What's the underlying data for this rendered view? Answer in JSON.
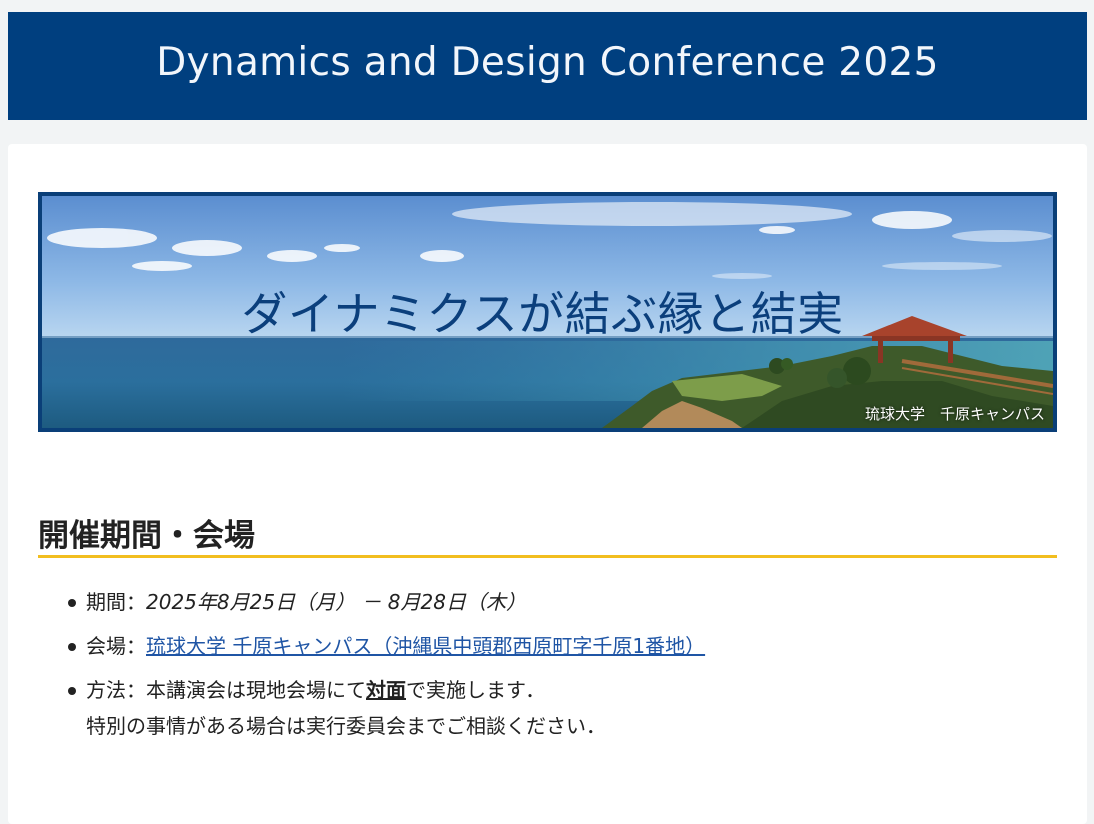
{
  "header": {
    "title": "Dynamics and Design Conference 2025"
  },
  "hero": {
    "title": "ダイナミクスが結ぶ縁と結実",
    "caption": "琉球大学　千原キャンパス"
  },
  "section": {
    "heading": "開催期間・会場"
  },
  "items": {
    "period_label": "期間：",
    "period_value": "2025年8月25日（月） － 8月28日（木）",
    "venue_label": "会場：",
    "venue_link": "琉球大学 千原キャンパス（沖縄県中頭郡西原町字千原1番地）",
    "method_label": "方法：",
    "method_pre": "本講演会は現地会場にて",
    "method_strong": "対面",
    "method_post": "で実施します．",
    "method_line2": "特別の事情がある場合は実行委員会までご相談ください．"
  },
  "colors": {
    "header_bg": "#003f7f",
    "accent_rule": "#f2be1f",
    "link": "#1f55a5"
  }
}
